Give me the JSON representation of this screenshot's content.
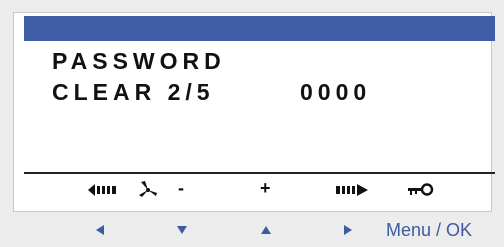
{
  "colors": {
    "header_bar": "#3f5ea5",
    "screen_bg": "#ffffff",
    "text": "#111111",
    "nav_accent": "#3c5ba1"
  },
  "display": {
    "line1": "PASSWORD",
    "line2": "CLEAR 2/5",
    "value": "0000"
  },
  "softkeys": {
    "left_icon": "scroll-left-icon",
    "fan_icon": "fan-icon",
    "minus_label": "-",
    "plus_label": "+",
    "right_icon": "scroll-right-icon",
    "key_icon": "key-icon"
  },
  "navigation": {
    "left": "arrow-left-icon",
    "down": "arrow-down-icon",
    "up": "arrow-up-icon",
    "right": "arrow-right-icon",
    "menu_ok_label": "Menu / OK"
  }
}
